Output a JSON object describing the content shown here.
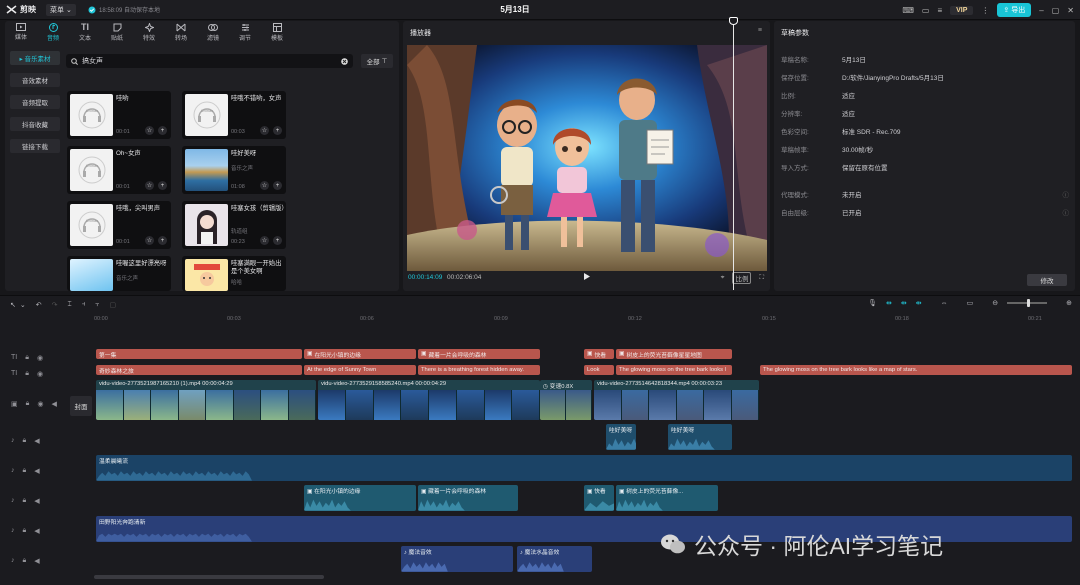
{
  "topbar": {
    "app_name": "剪映",
    "menu_label": "菜单",
    "autosave": "18:58:09 自动保存本地",
    "title": "5月13日",
    "vip": "VIP",
    "export": "导出"
  },
  "toolbar": {
    "tabs": [
      {
        "label": "媒体",
        "icon": "media-icon"
      },
      {
        "label": "音频",
        "icon": "audio-icon"
      },
      {
        "label": "文本",
        "icon": "text-icon"
      },
      {
        "label": "贴纸",
        "icon": "sticker-icon"
      },
      {
        "label": "特效",
        "icon": "effects-icon"
      },
      {
        "label": "转场",
        "icon": "transition-icon"
      },
      {
        "label": "滤镜",
        "icon": "filter-icon"
      },
      {
        "label": "调节",
        "icon": "adjust-icon"
      },
      {
        "label": "模板",
        "icon": "template-icon"
      }
    ],
    "active_index": 1
  },
  "sidebar": {
    "items": [
      "▸ 音乐素材",
      "音效素材",
      "音频提取",
      "抖音收藏",
      "链接下载"
    ]
  },
  "search": {
    "value": "搞女声",
    "filter_label": "全部"
  },
  "audio_items": [
    {
      "name": "哇哟",
      "meta": "",
      "duration": "00:01"
    },
    {
      "name": "哇哦不错哟，女声",
      "meta": "",
      "duration": "00:03"
    },
    {
      "name": "Oh~女声",
      "meta": "",
      "duration": "00:01"
    },
    {
      "name": "哇好美呀",
      "meta": "音乐之声",
      "duration": "01:08"
    },
    {
      "name": "哇哦，尖叫男声",
      "meta": "",
      "duration": "00:01"
    },
    {
      "name": "哇塞女孩（剪辑版）",
      "meta": "轨道组",
      "duration": "00:23"
    },
    {
      "name": "哇喔这里好漂亮呀",
      "meta": "音乐之声",
      "duration": ""
    },
    {
      "name": "哇塞满眼一开始出是个美女啊",
      "meta": "哈哈",
      "duration": ""
    }
  ],
  "player": {
    "title": "播放器",
    "time_current": "00:00:14:09",
    "time_total": "00:02:06:04",
    "ratio": "比例"
  },
  "params": {
    "title": "草稿参数",
    "rows": [
      {
        "k": "草稿名称:",
        "v": "5月13日"
      },
      {
        "k": "保存位置:",
        "v": "D:/软件/JianyingPro Drafts/5月13日"
      },
      {
        "k": "比例:",
        "v": "适应"
      },
      {
        "k": "分辨率:",
        "v": "适应"
      },
      {
        "k": "色彩空间:",
        "v": "标准 SDR - Rec.709"
      },
      {
        "k": "草稿帧率:",
        "v": "30.00帧/秒"
      },
      {
        "k": "导入方式:",
        "v": "保留在原有位置"
      },
      {
        "k": "代理模式:",
        "v": "未开启"
      },
      {
        "k": "自由层级:",
        "v": "已开启"
      }
    ],
    "modify_label": "修改"
  },
  "timeline": {
    "ruler": [
      "00:00",
      "00:03",
      "00:06",
      "00:09",
      "00:12",
      "00:15",
      "00:18",
      "00:21"
    ],
    "cover_label": "封面",
    "text_track_1": [
      "第一集",
      "在阳光小镇的边缘",
      "藏着一片会呼吸的森林",
      "快看",
      "树皮上的荧光苔藓像星星地图"
    ],
    "text_track_2": [
      "奇妙森林之旅",
      "At the edge of Sunny Town",
      "There is a breathing forest hidden away.",
      "Look",
      "The glowing moss on the tree bark looks l",
      "The glowing moss on the tree bark looks like a map of stars."
    ],
    "video_clips": [
      "vidu-video-2773521987165210 (1).mp4  00:00:04:29",
      "vidu-video-2773529158585240.mp4  00:00:04:29",
      "变速0.8X",
      "vidu-video-2773514642818344.mp4  00:00:03:23"
    ],
    "sfx_clips": [
      "哇好美呀",
      "哇好美呀"
    ],
    "music_1": "温柔晨曦流",
    "voice_clips": [
      "在阳光小镇的边缘",
      "藏着一片会呼吸的森林",
      "快看",
      "树皮上的荧光苔藓像..."
    ],
    "music_2": "田野阳光奔跑清新",
    "magic_clips": [
      "魔法音效",
      "魔法水晶音效"
    ]
  },
  "watermark": "公众号 · 阿伦AI学习笔记",
  "colors": {
    "accent": "#21c7d9",
    "text_clip": "#b9564d",
    "video_clip": "#20424b",
    "audio_clip": "#1f4e6c"
  }
}
